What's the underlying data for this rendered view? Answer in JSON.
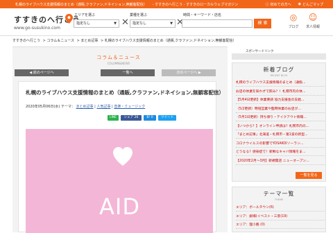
{
  "topbar": {
    "text1": "札幌のライブハウス支援情報のまとめ（通販,クラファン,ドネイション,無観客配信）",
    "text2": "- すすきのへ行こう - すすきのローカルウェブマガジン",
    "first_visit": "初めての方へ",
    "dig": "どんごマップ"
  },
  "header": {
    "logo_text": "すすきのへ行こう",
    "logo_url": "www.go-susukino.com",
    "area_label": "エリアを選ぶ",
    "area_value": "指定なし",
    "genre_label": "業種を選ぶ",
    "genre_value": "指定なし",
    "kw_label": "時間・キーワード・店名",
    "search_label": "検 索",
    "blog_label": "ブログ",
    "job_label": "求人情報"
  },
  "breadcrumb": {
    "home": "すすきのへ行こう",
    "news": "コラム＆ニュース",
    "matome": "まとめ記事",
    "current": "札幌のライブハウス支援情報のまとめ（通販,クラファン,ドネイション,無観客配信）"
  },
  "section": {
    "title": "コラム＆ニュース",
    "subtitle": "COLUMN&NEWS"
  },
  "pager": {
    "prev": "◀ 前のページへ",
    "list": "一覧へ",
    "next": "次のページへ ▶"
  },
  "article": {
    "title": "札幌のライブハウス支援情報のまとめ（通販,クラファン,ドネイション,無観客配信）",
    "date": "2020年05月06日(水) テーマ：",
    "tag1": "まとめ記事",
    "tag2": "人気記事",
    "tag3": "音楽・ミュージック",
    "line": "LINE",
    "share": "シェア 26",
    "b": "B! 0",
    "tweet": "ツイート",
    "hero_text": "AID",
    "hero_color": "#f4b6d6"
  },
  "sidebar": {
    "ad_label": "スポンサードリンク",
    "blog_title": "新着ブログ",
    "blog_sub": "RECENT BLOG",
    "blogs": [
      "札幌のライブハウス支援情報のまとめ（通販...",
      "お店の休業を知れずで飲み？！札幌市内の休...",
      "【5月4日更新】休業要請 協力支援金の支給...",
      "（5/2更新）時短営業や臨時休業のお店が...",
      "（5月1日更新）持ち帰り・テイクアウト情報...",
      "【いつから？】オンライン申請は？札幌市内の...",
      "「まとめ記事」北海道・札幌市・第1波の新型...",
      "コロナウイルスの影響でYOSAKOIソーラン...",
      "どうなる？感染症で！新鮮なキャバ情報をま...",
      "【2020年2月〜3月】新規開店 ニューオープン..."
    ],
    "more": "一覧を見る",
    "theme_title": "テーマ一覧",
    "theme_sub": "THEME",
    "themes": [
      "エリア：ボールタウン(6)",
      "エリア：劇場(イベスト・三景(19)",
      "エリア：狸小路 (0)"
    ]
  }
}
